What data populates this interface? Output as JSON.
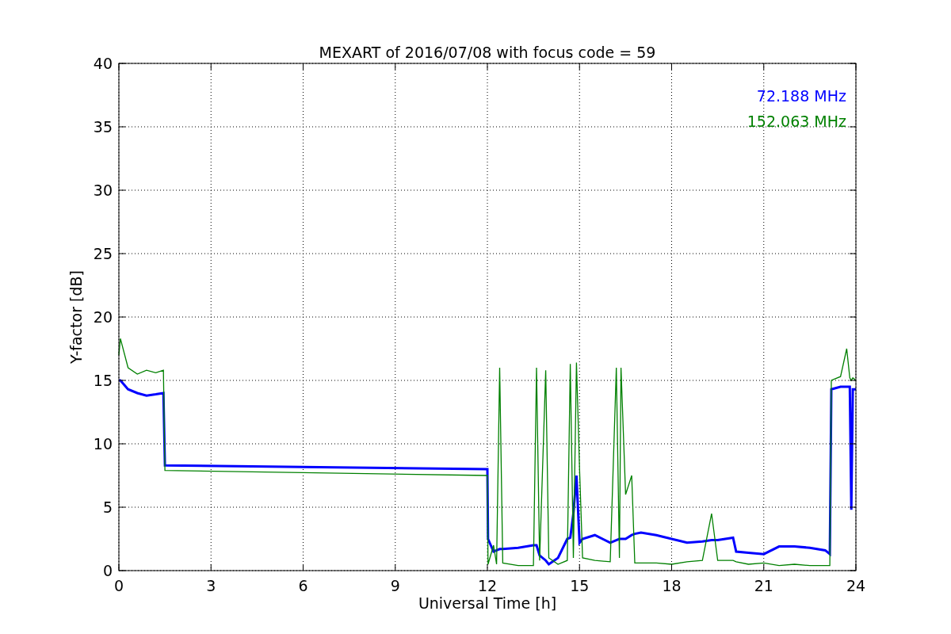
{
  "chart_data": {
    "type": "line",
    "grid": true,
    "title": "MEXART of 2016/07/08 with focus code = 59",
    "xlabel": "Universal Time [h]",
    "ylabel": "Y-factor [dB]",
    "xlim": [
      0,
      24
    ],
    "ylim": [
      0,
      40
    ],
    "xticks": [
      0,
      3,
      6,
      9,
      12,
      15,
      18,
      21,
      24
    ],
    "yticks": [
      0,
      5,
      10,
      15,
      20,
      25,
      30,
      35,
      40
    ],
    "x": [
      0,
      0.05,
      0.3,
      0.6,
      0.9,
      1.2,
      1.45,
      1.5,
      12,
      12.02,
      12.2,
      12.3,
      12.4,
      12.5,
      13,
      13.5,
      13.6,
      13.7,
      13.9,
      14,
      14.3,
      14.6,
      14.7,
      14.8,
      14.9,
      15,
      15.1,
      15.5,
      16,
      16.2,
      16.3,
      16.35,
      16.5,
      16.7,
      16.8,
      17,
      17.5,
      18,
      18.5,
      19,
      19.3,
      19.5,
      20,
      20.1,
      20.5,
      21,
      21.5,
      22,
      22.5,
      23,
      23.15,
      23.2,
      23.5,
      23.7,
      23.8,
      23.85,
      23.9,
      24
    ],
    "series": [
      {
        "name": "72.188 MHz",
        "color": "#0000ff",
        "values": [
          15,
          15,
          14.3,
          14,
          13.8,
          13.9,
          14,
          8.3,
          8,
          2.5,
          1.5,
          1.6,
          1.7,
          1.7,
          1.8,
          2,
          2,
          1.2,
          0.8,
          0.5,
          1,
          2.5,
          2.6,
          4.5,
          7.5,
          2.2,
          2.5,
          2.8,
          2.2,
          2.4,
          2.5,
          2.5,
          2.5,
          2.8,
          2.9,
          3,
          2.8,
          2.5,
          2.2,
          2.3,
          2.4,
          2.4,
          2.6,
          1.5,
          1.4,
          1.3,
          1.9,
          1.9,
          1.8,
          1.6,
          1.3,
          14.3,
          14.5,
          14.5,
          14.5,
          4.8,
          14.3,
          14.3
        ]
      },
      {
        "name": "152.063 MHz",
        "color": "#008000",
        "values": [
          17,
          18.3,
          16,
          15.5,
          15.8,
          15.6,
          15.8,
          7.9,
          7.5,
          0.5,
          2,
          0.5,
          16,
          0.6,
          0.4,
          0.4,
          16,
          0.8,
          15.8,
          1,
          0.5,
          0.8,
          16.3,
          1,
          16.4,
          8,
          1,
          0.8,
          0.7,
          16,
          1,
          16,
          6,
          7.5,
          0.6,
          0.6,
          0.6,
          0.5,
          0.7,
          0.8,
          4.5,
          0.8,
          0.8,
          0.7,
          0.5,
          0.6,
          0.4,
          0.5,
          0.4,
          0.4,
          0.4,
          15,
          15.3,
          17.5,
          15.2,
          15,
          15.2,
          15
        ]
      }
    ]
  }
}
